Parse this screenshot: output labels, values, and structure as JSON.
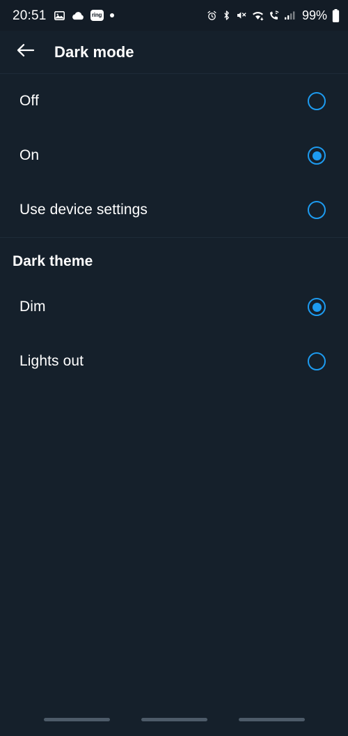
{
  "status_bar": {
    "time": "20:51",
    "left_icons": [
      {
        "name": "photo-icon",
        "label": "photo"
      },
      {
        "name": "cloud-icon",
        "label": "cloud"
      },
      {
        "name": "ring-badge-icon",
        "label": "ring"
      },
      {
        "name": "dot-indicator-icon",
        "label": "dot"
      }
    ],
    "right_icons": [
      {
        "name": "alarm-icon",
        "label": "alarm"
      },
      {
        "name": "bluetooth-icon",
        "label": "bluetooth"
      },
      {
        "name": "volume-mute-icon",
        "label": "muted"
      },
      {
        "name": "wifi-icon",
        "label": "wifi"
      },
      {
        "name": "wifi-calling-icon",
        "label": "wifi-calling"
      },
      {
        "name": "cellular-signal-icon",
        "label": "signal"
      }
    ],
    "battery_percent": "99%",
    "battery_icon": "battery-icon"
  },
  "app_bar": {
    "back_icon": "back-arrow-icon",
    "title": "Dark mode"
  },
  "colors": {
    "background": "#15202b",
    "status_bar_background": "#131c26",
    "accent": "#1d9bf0",
    "divider": "#1e2b38",
    "text": "#ffffff",
    "nav_pill": "#4d5b69"
  },
  "dark_mode_group": {
    "options": [
      {
        "label": "Off",
        "selected": false
      },
      {
        "label": "On",
        "selected": true
      },
      {
        "label": "Use device settings",
        "selected": false
      }
    ]
  },
  "dark_theme_section": {
    "header": "Dark theme",
    "options": [
      {
        "label": "Dim",
        "selected": true
      },
      {
        "label": "Lights out",
        "selected": false
      }
    ]
  },
  "nav_bar": {
    "items": [
      {
        "name": "nav-pill-recents"
      },
      {
        "name": "nav-pill-home"
      },
      {
        "name": "nav-pill-back"
      }
    ]
  }
}
